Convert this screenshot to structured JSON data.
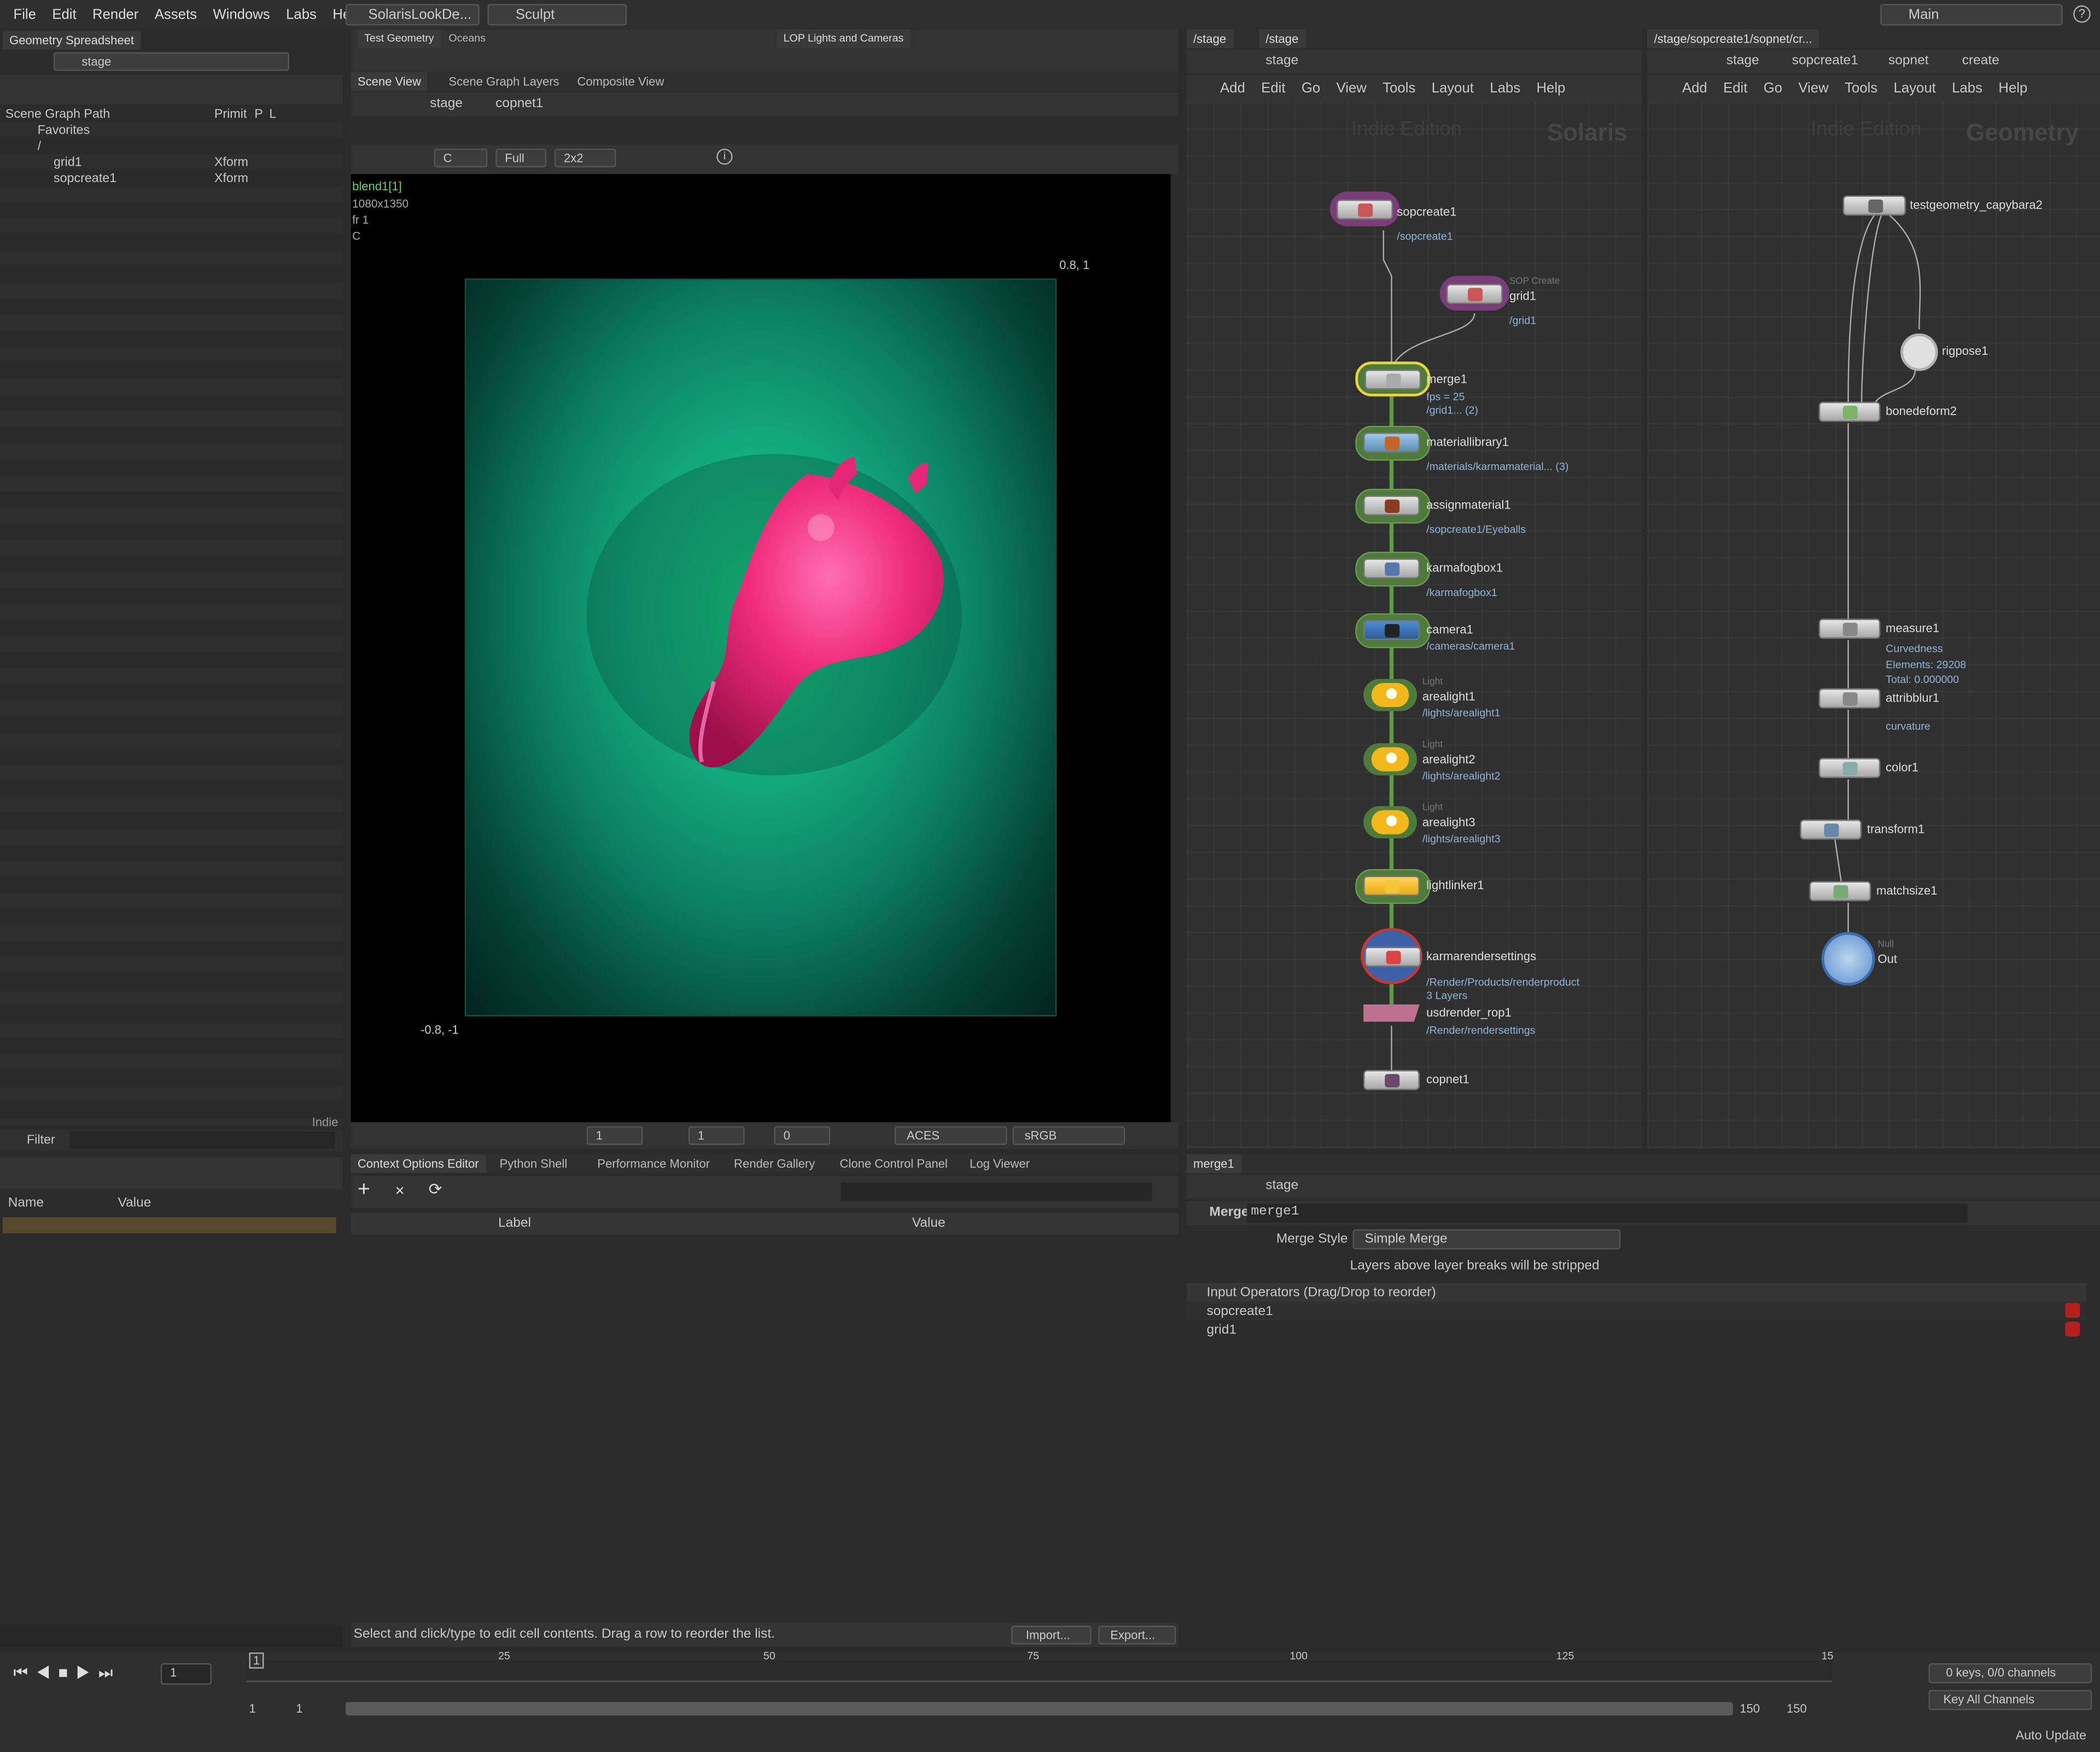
{
  "menubar": {
    "items": [
      "File",
      "Edit",
      "Render",
      "Assets",
      "Windows",
      "Labs",
      "Help"
    ],
    "desktop": "SolarisLookDe...",
    "sculpt": "Sculpt",
    "workspace": "Main"
  },
  "shelf_left": {
    "tabs": [
      "Test Geometry",
      "Oceans"
    ]
  },
  "shelf_right": {
    "tabs": [
      "LOP Lights and Cameras"
    ]
  },
  "left_panel": {
    "tab": "Geometry Spreadsheet",
    "path": "stage",
    "headers": {
      "path": "Scene Graph Path",
      "primit": "Primit",
      "p": "P",
      "l": "L"
    },
    "favorites": "Favorites",
    "root": "/",
    "rows": [
      {
        "name": "grid1",
        "type": "Xform"
      },
      {
        "name": "sopcreate1",
        "type": "Xform"
      }
    ],
    "indie": "Indie",
    "filter": "Filter"
  },
  "params_left": {
    "col_name": "Name",
    "col_value": "Value"
  },
  "viewer": {
    "tabs": [
      "Scene View",
      "Scene Graph Layers",
      "Composite View"
    ],
    "path": [
      "stage",
      "copnet1"
    ],
    "toolbar": {
      "channel": "C",
      "res": "Full",
      "tile": "2x2"
    },
    "info": [
      "blend1[1]",
      "1080x1350",
      "fr 1",
      "C"
    ],
    "corner_tr": "0.8, 1",
    "corner_bl": "-0.8, -1",
    "bottom": {
      "v1": "1",
      "v2": "1",
      "v3": "0",
      "lut": "ACES",
      "space": "sRGB"
    }
  },
  "lower_tabs": [
    "Context Options Editor",
    "Python Shell",
    "Performance Monitor",
    "Render Gallery",
    "Clone Control Panel",
    "Log Viewer"
  ],
  "context_editor": {
    "col_label": "Label",
    "col_value": "Value",
    "status": "Select and click/type to edit cell contents. Drag a row to reorder the list.",
    "import": "Import...",
    "export": "Export..."
  },
  "net_stage": {
    "tabs": [
      "/stage",
      "/stage"
    ],
    "path": "stage",
    "menu": [
      "Add",
      "Edit",
      "Go",
      "View",
      "Tools",
      "Layout",
      "Labs",
      "Help"
    ],
    "edition": "Indie Edition",
    "context": "Solaris",
    "nodes": {
      "sopcreate1": {
        "label": "sopcreate1",
        "sub": "/sopcreate1"
      },
      "grid1": {
        "label": "grid1",
        "sub": "/grid1",
        "type": "SOP Create"
      },
      "merge1": {
        "label": "merge1",
        "sub1": "fps = 25",
        "sub2": "/grid1... (2)"
      },
      "materiallibrary1": {
        "label": "materiallibrary1",
        "sub": "/materials/karmamaterial... (3)"
      },
      "assignmaterial1": {
        "label": "assignmaterial1",
        "sub": "/sopcreate1/Eyeballs"
      },
      "karmafogbox1": {
        "label": "karmafogbox1",
        "sub": "/karmafogbox1"
      },
      "camera1": {
        "label": "camera1",
        "sub": "/cameras/camera1"
      },
      "arealight1": {
        "label": "arealight1",
        "sub": "/lights/arealight1",
        "type": "Light"
      },
      "arealight2": {
        "label": "arealight2",
        "sub": "/lights/arealight2",
        "type": "Light"
      },
      "arealight3": {
        "label": "arealight3",
        "sub": "/lights/arealight3",
        "type": "Light"
      },
      "lightlinker1": {
        "label": "lightlinker1"
      },
      "karmarendersettings": {
        "label": "karmarendersettings",
        "sub1": "/Render/Products/renderproduct",
        "sub2": "3 Layers"
      },
      "usdrender_rop1": {
        "label": "usdrender_rop1",
        "sub": "/Render/rendersettings"
      },
      "copnet1": {
        "label": "copnet1"
      }
    }
  },
  "net_geo": {
    "tab": "/stage/sopcreate1/sopnet/cr...",
    "path": [
      "stage",
      "sopcreate1",
      "sopnet",
      "create"
    ],
    "menu": [
      "Add",
      "Edit",
      "Go",
      "View",
      "Tools",
      "Layout",
      "Labs",
      "Help"
    ],
    "edition": "Indie Edition",
    "context": "Geometry",
    "nodes": {
      "testgeometry": "testgeometry_capybara2",
      "rigpose": "rigpose1",
      "bonedeform": "bonedeform2",
      "measure": {
        "label": "measure1",
        "sub1": "Curvedness",
        "sub2": "Elements: 29208",
        "sub3": "Total: 0.000000"
      },
      "attribblur": {
        "label": "attribblur1",
        "sub": "curvature"
      },
      "color": "color1",
      "transform": "transform1",
      "matchsize": "matchsize1",
      "out": {
        "label": "Out",
        "type": "Null"
      }
    }
  },
  "parm": {
    "tab": "merge1",
    "path": "stage",
    "type": "Merge",
    "name": "merge1",
    "style_label": "Merge Style",
    "style_value": "Simple Merge",
    "note": "Layers above layer breaks will be stripped",
    "inputs_header": "Input Operators (Drag/Drop to reorder)",
    "inputs": [
      "sopcreate1",
      "grid1"
    ]
  },
  "timeline": {
    "frame": "1",
    "marker": "1",
    "ticks": [
      "25",
      "50",
      "75",
      "100",
      "125",
      "15"
    ],
    "start": "1",
    "start2": "1",
    "end": "150",
    "end2": "150",
    "keys": "0 keys, 0/0 channels",
    "key_all": "Key All Channels",
    "auto_update": "Auto Update"
  },
  "colors": {
    "bg": "#2b2b2b",
    "panel": "#353535",
    "accent": "#f2b81c",
    "node_path": "#8fb4d8",
    "green": "#4e7a3c"
  }
}
